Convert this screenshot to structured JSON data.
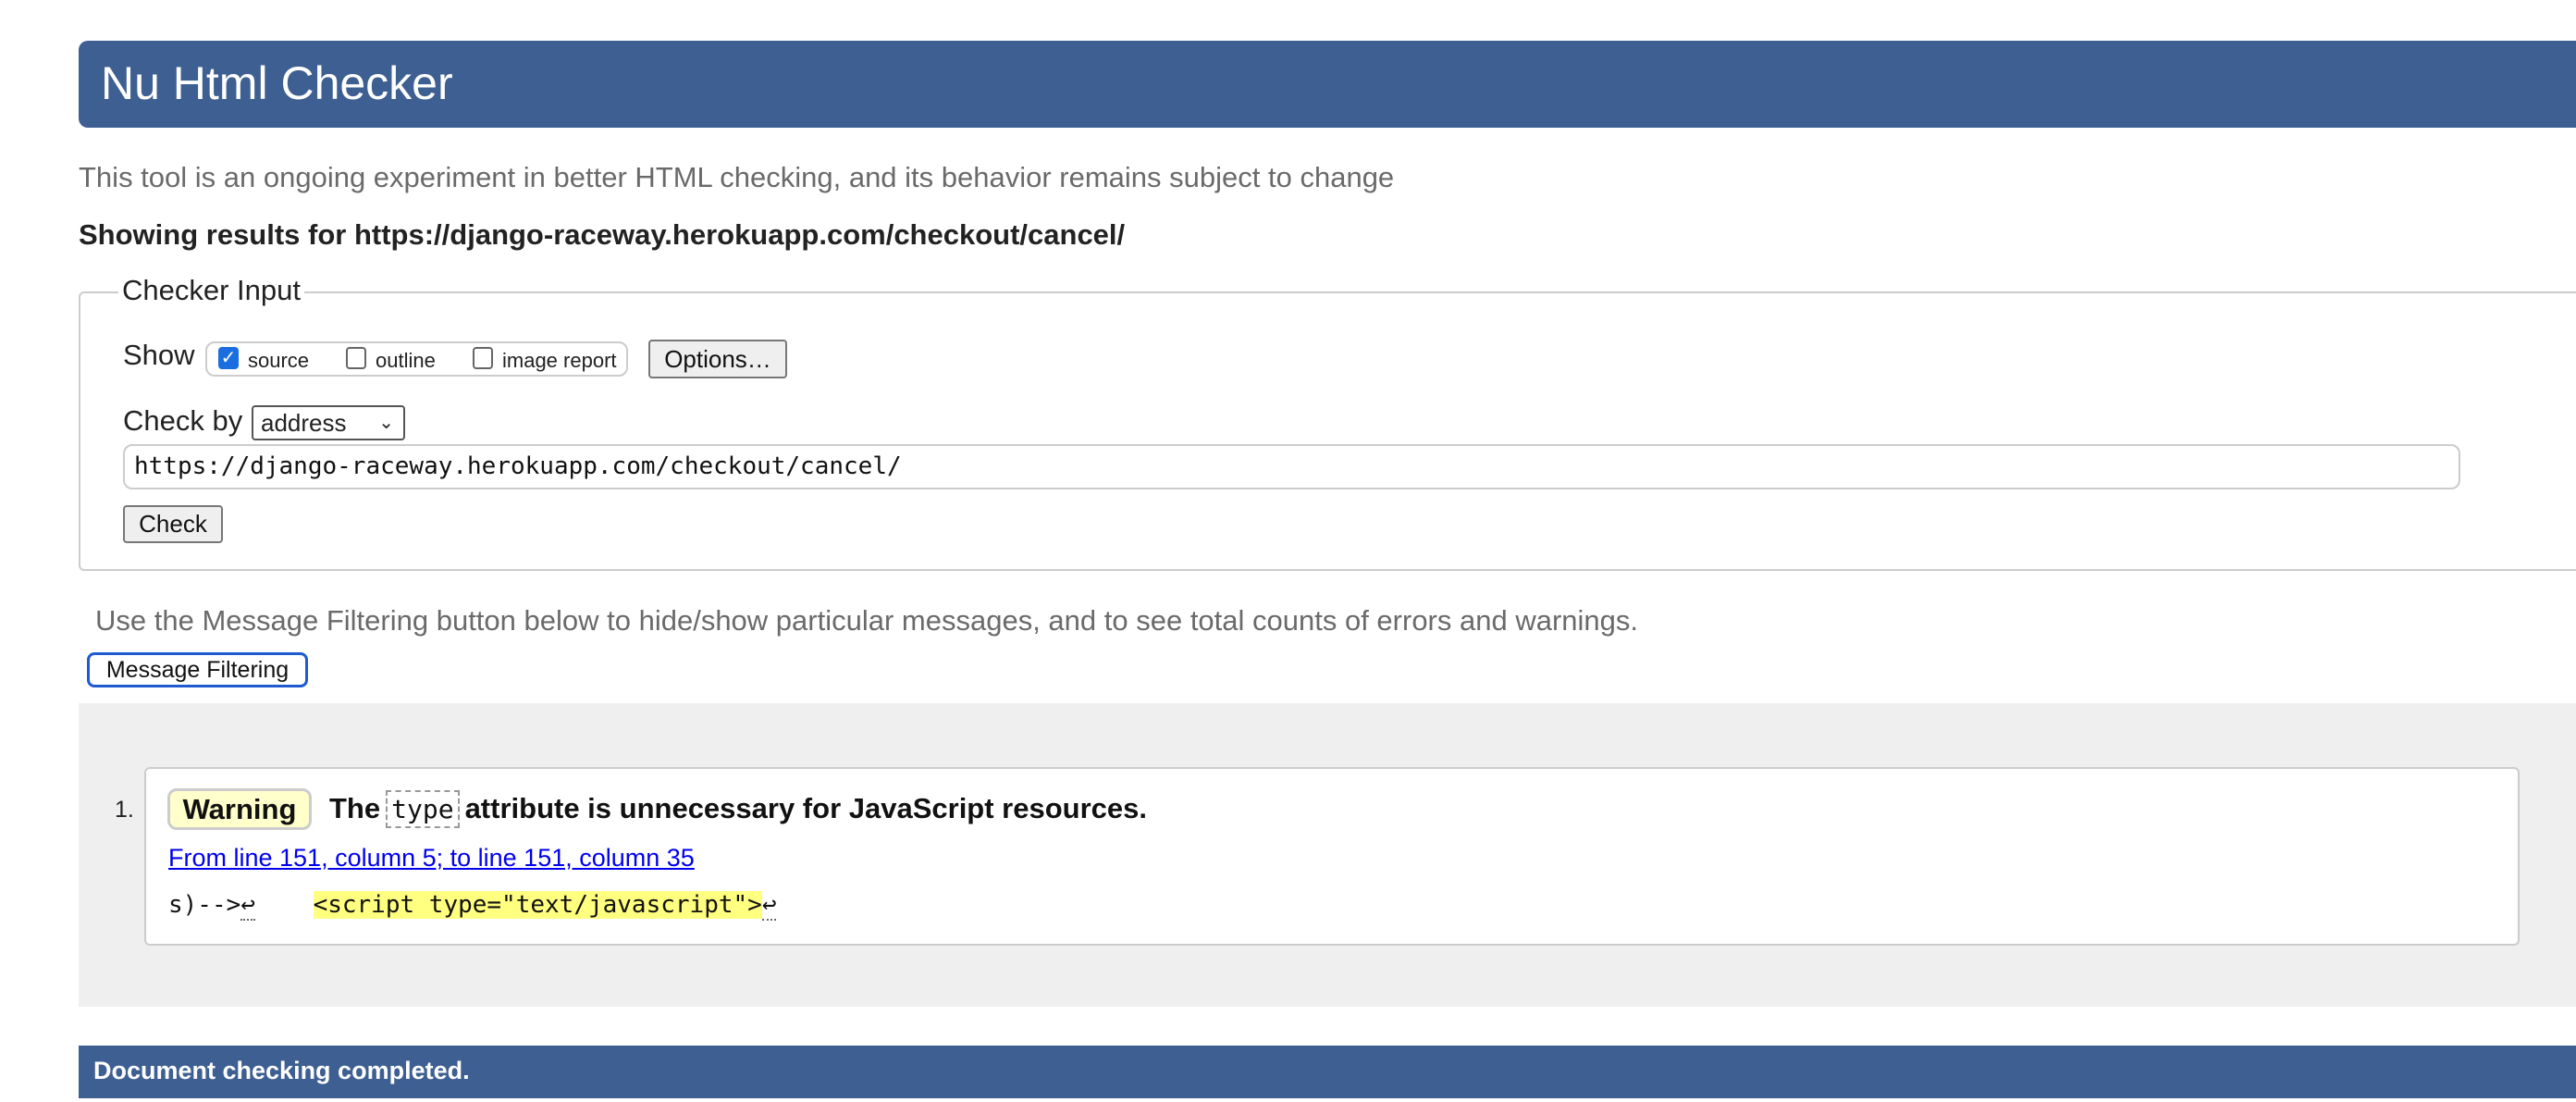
{
  "header": {
    "title": "Nu Html Checker"
  },
  "subtitle": "This tool is an ongoing experiment in better HTML checking, and its behavior remains subject to change",
  "showing_results": "Showing results for https://django-raceway.herokuapp.com/checkout/cancel/",
  "checker_input": {
    "legend": "Checker Input",
    "show_label": "Show",
    "show_options": [
      {
        "label": "source",
        "checked": true
      },
      {
        "label": "outline",
        "checked": false
      },
      {
        "label": "image report",
        "checked": false
      }
    ],
    "options_button": "Options…",
    "check_by_label": "Check by",
    "check_by_value": "address",
    "url_value": "https://django-raceway.herokuapp.com/checkout/cancel/",
    "check_button": "Check"
  },
  "filter_note": "Use the Message Filtering button below to hide/show particular messages, and to see total counts of errors and warnings.",
  "filter_button": "Message Filtering",
  "messages": [
    {
      "number": "1.",
      "type": "Warning",
      "text_before": "The",
      "code": "type",
      "text_after": "attribute is unnecessary for JavaScript resources.",
      "location": "From line 151, column 5; to line 151, column 35",
      "extract_before": "s)-->",
      "extract_highlight": "<script type=\"text/javascript\">",
      "return_glyph": "↩"
    }
  ],
  "footer": "Document checking completed.",
  "colors": {
    "brand": "#3e5f92",
    "warning_bg": "#ffffcc",
    "highlight": "#ffff80",
    "link": "#0000ee"
  }
}
